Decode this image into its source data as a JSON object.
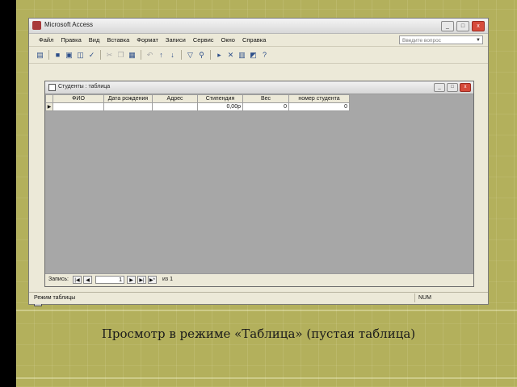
{
  "window": {
    "title": "Microsoft Access",
    "buttons": [
      "_",
      "□",
      "x"
    ]
  },
  "menu": {
    "items": [
      "Файл",
      "Правка",
      "Вид",
      "Вставка",
      "Формат",
      "Записи",
      "Сервис",
      "Окно",
      "Справка"
    ]
  },
  "help": {
    "placeholder": "Введите вопрос"
  },
  "toolbar": {
    "icons": [
      "view-icon",
      "save-icon",
      "print-icon",
      "print-preview-icon",
      "spelling-icon",
      "cut-icon",
      "copy-icon",
      "paste-icon",
      "undo-icon",
      "sort-asc-icon",
      "sort-desc-icon",
      "filter-icon",
      "find-icon",
      "new-record-icon",
      "delete-record-icon",
      "database-window-icon",
      "new-object-icon",
      "help-icon"
    ]
  },
  "table_window": {
    "title": "Студенты : таблица",
    "columns": [
      "ФИО",
      "Дата рождения",
      "Адрес",
      "Стипендия",
      "Вес",
      "номер студента"
    ],
    "new_row": [
      "",
      "",
      "",
      "0,00р",
      "0",
      "0"
    ],
    "row_selector": "▶"
  },
  "navigation": {
    "label": "Запись:",
    "current": "1",
    "of_label": "из",
    "total": "1"
  },
  "status": {
    "mode": "Режим таблицы",
    "num": "NUM"
  },
  "caption": "Просмотр в режиме «Таблица» (пустая таблица)",
  "colors": {
    "slide_bg": "#b3b05c",
    "grid_bg": "#a7a7a7",
    "chrome": "#ece9d8"
  }
}
